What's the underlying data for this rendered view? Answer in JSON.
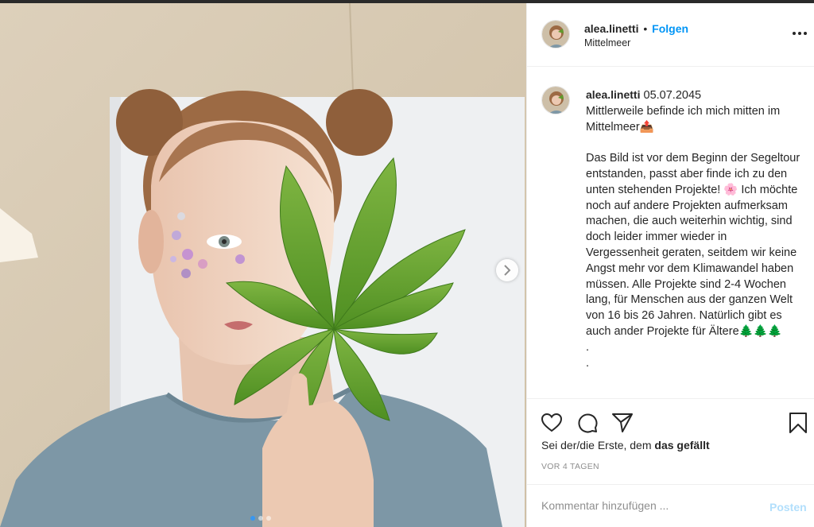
{
  "post": {
    "username": "alea.linetti",
    "follow_label": "Folgen",
    "location": "Mittelmeer",
    "date": "05.07.2045",
    "caption_lines": [
      "Mittlerweile befinde ich mich mitten im Mittelmeer📤",
      "",
      "Das Bild ist vor dem Beginn der Segeltour entstanden, passt aber finde ich zu den unten stehenden Projekte! 🌸 Ich möchte noch auf andere Projekten aufmerksam machen, die auch weiterhin wichtig, sind doch leider immer wieder in Vergessenheit geraten, seitdem wir keine Angst mehr vor dem Klimawandel haben müssen. Alle Projekte sind 2-4 Wochen lang, für Menschen aus der ganzen Welt von 16 bis 26 Jahren. Natürlich gibt es auch ander Projekte für Ältere🌲🌲🌲",
      ".",
      "."
    ],
    "likes_prefix": "Sei der/die Erste, dem ",
    "likes_bold": "das gefällt",
    "time_ago": "VOR 4 TAGEN",
    "comment_placeholder": "Kommentar hinzufügen ...",
    "post_label": "Posten",
    "carousel": {
      "slide_count": 3,
      "active_index": 0
    }
  },
  "icons": [
    "more-icon",
    "heart-icon",
    "comment-icon",
    "share-icon",
    "bookmark-icon",
    "chevron-right-icon"
  ],
  "colors": {
    "follow": "#0095f6",
    "post_disabled": "#b2dffc",
    "muted": "#8e8e8e",
    "text": "#262626",
    "active_dot": "#3897f0"
  }
}
